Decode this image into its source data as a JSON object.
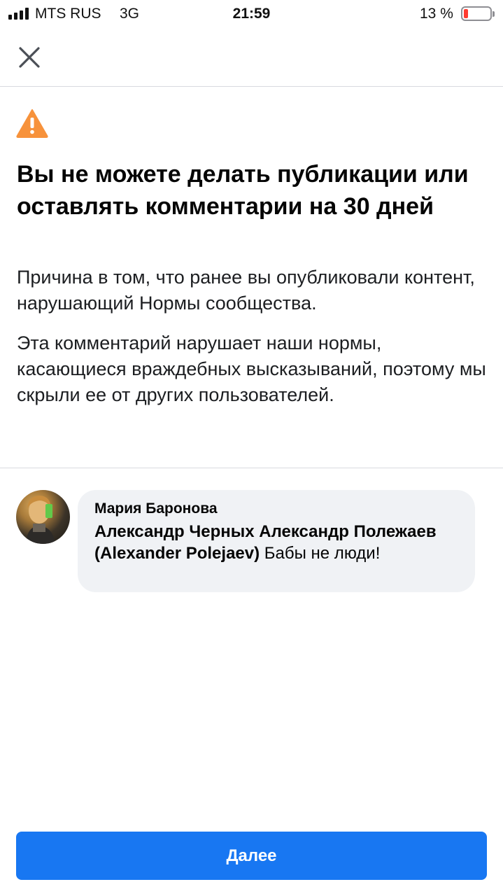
{
  "status_bar": {
    "carrier": "MTS RUS",
    "network": "3G",
    "time": "21:59",
    "battery_percent": "13 %",
    "battery_level": 0.13
  },
  "header": {
    "close_icon": "close-icon"
  },
  "notice": {
    "icon": "warning-icon",
    "icon_color": "#f7923b",
    "title": "Вы не можете делать публикации или оставлять комментарии на 30 дней",
    "reason": "Причина в том, что ранее вы опубликовали контент, нарушающий Нормы сообщества.",
    "detail": "Эта комментарий нарушает наши нормы, касающиеся враждебных высказываний, поэтому мы скрыли ее от других пользователей."
  },
  "comment": {
    "author": "Мария Баронова",
    "mentions": "Александр Черных Александр Полежаев (Alexander Polejaev)",
    "text": " Бабы не люди!"
  },
  "actions": {
    "next_label": "Далее",
    "accent_color": "#1877f2"
  }
}
